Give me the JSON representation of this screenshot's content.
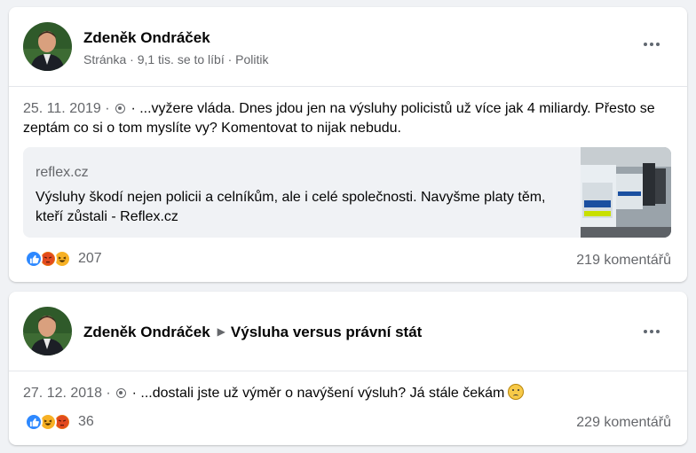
{
  "posts": [
    {
      "author": "Zdeněk Ondráček",
      "meta": "Stránka · 9,1 tis. se to líbí · Politik",
      "date": "25. 11. 2019 · ",
      "text": " · ...vyžere vláda. Dnes jdou jen na výsluhy policistů už více jak 4 miliardy. Přesto se zeptám co si o tom myslíte vy? Komentovat to nijak nebudu.",
      "link": {
        "domain": "reflex.cz",
        "title": "Výsluhy škodí nejen policii a celníkům, ale i celé společnosti. Navyšme platy těm, kteří zůstali - Reflex.cz"
      },
      "reactions": [
        "like-icon",
        "angry-icon",
        "haha-icon"
      ],
      "reaction_count": "207",
      "comments": "219 komentářů"
    },
    {
      "author": "Zdeněk Ondráček",
      "group": "Výsluha versus právní stát",
      "date": "27. 12. 2018 · ",
      "text": " · ...dostali jste už výměr o navýšení výsluh? Já stále čekám",
      "reactions": [
        "like-icon",
        "haha-icon",
        "angry-icon"
      ],
      "reaction_count": "36",
      "comments": "229 komentářů"
    }
  ],
  "colors": {
    "like": "#2d88ff",
    "angry": "#e9710f",
    "haha": "#f7b125",
    "secondary_text": "#65676b"
  }
}
